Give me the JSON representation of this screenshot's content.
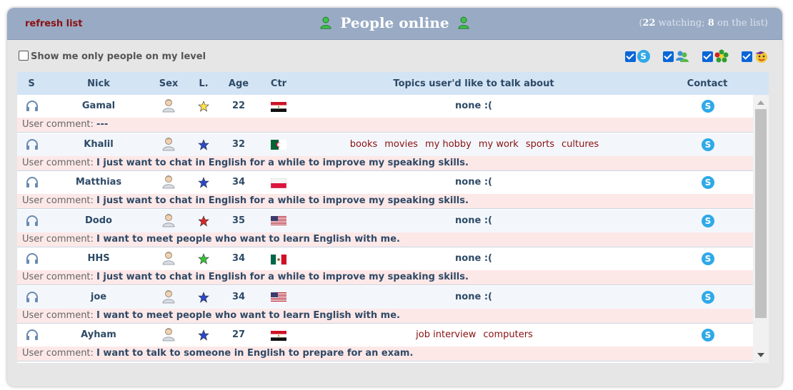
{
  "header": {
    "refresh_label": "refresh list",
    "title": "People online",
    "counts": {
      "watching_num": "22",
      "watching_label": "watching;",
      "list_num": "8",
      "list_label": "on the list"
    }
  },
  "filters": {
    "level_label": "Show me only people on my level",
    "level_checked": false,
    "options": [
      {
        "name": "skype",
        "checked": true
      },
      {
        "name": "msn",
        "checked": true
      },
      {
        "name": "icq",
        "checked": true
      },
      {
        "name": "yahoo",
        "checked": true
      }
    ]
  },
  "table": {
    "columns": {
      "s": "S",
      "nick": "Nick",
      "sex": "Sex",
      "level": "L.",
      "age": "Age",
      "country": "Ctr",
      "topics": "Topics user'd like to talk about",
      "contact": "Contact"
    },
    "comment_prefix": "User comment:",
    "rows": [
      {
        "nick": "Gamal",
        "age": "22",
        "star": "#ffe24a",
        "country": "eg",
        "topics": [],
        "none_text": "none :(",
        "comment": "---"
      },
      {
        "nick": "Khalil",
        "age": "32",
        "star": "#2a49c9",
        "country": "dz",
        "topics": [
          "books",
          "movies",
          "my hobby",
          "my work",
          "sports",
          "cultures"
        ],
        "none_text": "",
        "comment": "I just want to chat in English for a while to improve my speaking skills."
      },
      {
        "nick": "Matthias",
        "age": "34",
        "star": "#2a49c9",
        "country": "pl",
        "topics": [],
        "none_text": "none :(",
        "comment": "I just want to chat in English for a while to improve my speaking skills."
      },
      {
        "nick": "Dodo",
        "age": "35",
        "star": "#d8262b",
        "country": "us",
        "topics": [],
        "none_text": "none :(",
        "comment": "I want to meet people who want to learn English with me."
      },
      {
        "nick": "HHS",
        "age": "34",
        "star": "#35c23a",
        "country": "mx",
        "topics": [],
        "none_text": "none :(",
        "comment": "I just want to chat in English for a while to improve my speaking skills."
      },
      {
        "nick": "joe",
        "age": "34",
        "star": "#2a49c9",
        "country": "us",
        "topics": [],
        "none_text": "none :(",
        "comment": "I want to meet people who want to learn English with me."
      },
      {
        "nick": "Ayham",
        "age": "27",
        "star": "#2a49c9",
        "country": "eg",
        "topics": [
          "job interview",
          "computers"
        ],
        "none_text": "",
        "comment": "I want to talk to someone in English to prepare for an exam."
      }
    ]
  },
  "colors": {
    "header_bg": "#99aac4",
    "refresh": "#8a1010",
    "table_head": "#d3e4f5",
    "comment_bg": "#fde8e8",
    "skype": "#2fa9e8"
  }
}
